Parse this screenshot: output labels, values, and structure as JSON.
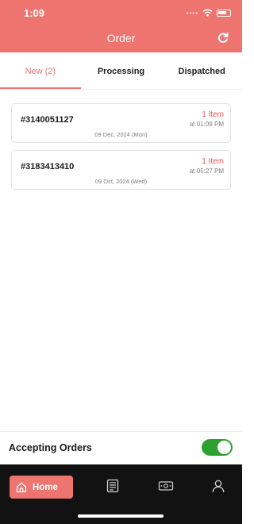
{
  "status_bar": {
    "time": "1:09"
  },
  "header": {
    "title": "Order"
  },
  "tabs": [
    {
      "label": "New (2)"
    },
    {
      "label": "Processing"
    },
    {
      "label": "Dispatched"
    }
  ],
  "orders": [
    {
      "id": "#3140051127",
      "items": "1 Item",
      "time": "at 01:09 PM",
      "date": "09 Dec, 2024 (Mon)"
    },
    {
      "id": "#3183413410",
      "items": "1 Item",
      "time": "at 05:27 PM",
      "date": "09 Oct, 2024 (Wed)"
    }
  ],
  "accepting": {
    "label": "Accepting Orders",
    "enabled": true
  },
  "nav": {
    "home_label": "Home"
  },
  "colors": {
    "brand": "#ee7470",
    "toggle_on": "#2ea02f",
    "nav_bg": "#121212"
  }
}
